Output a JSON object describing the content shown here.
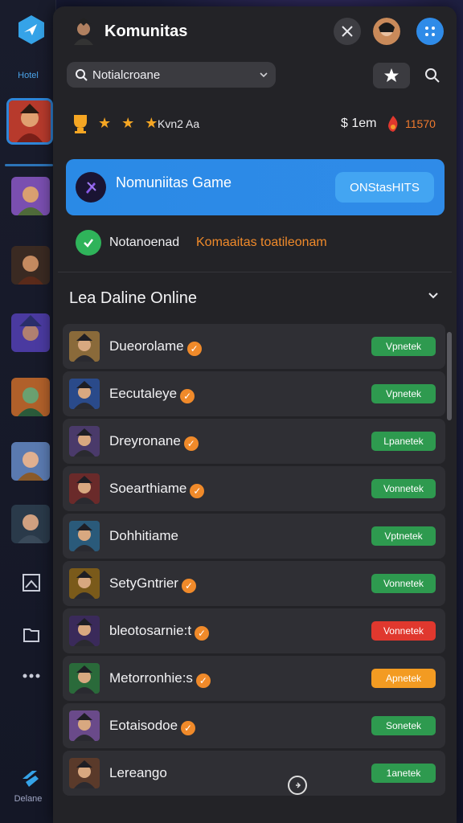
{
  "rail": {
    "top_label": "Hotel",
    "bottom_label": "Delane"
  },
  "header": {
    "title": "Komunitas"
  },
  "search": {
    "value": "Notialcroane"
  },
  "stats": {
    "stars": "★ ★ ★",
    "rating": "Kvn2 Aa",
    "price": "$ 1em",
    "count": "11570"
  },
  "banner": {
    "title": "Nomuniitas Game",
    "button": "ONStasHITS"
  },
  "notice": {
    "status": "Notanoenad",
    "highlight": "Komaaitas toatileonam"
  },
  "section": {
    "title": "Lea Daline Online"
  },
  "colors": {
    "green": "#2e9a4f",
    "red": "#e0382e",
    "orange": "#f39b22",
    "accent": "#2f8be8"
  },
  "list": [
    {
      "name": "Dueorolame",
      "badge": true,
      "button": "Vpnetek",
      "status": "green"
    },
    {
      "name": "Eecutaleye",
      "badge": true,
      "button": "Vpnetek",
      "status": "green"
    },
    {
      "name": "Dreyronane",
      "badge": true,
      "button": "Lpanetek",
      "status": "green"
    },
    {
      "name": "Soearthiame",
      "badge": true,
      "button": "Vonnetek",
      "status": "green"
    },
    {
      "name": "Dohhitiame",
      "badge": false,
      "button": "Vptnetek",
      "status": "green"
    },
    {
      "name": "SetyGntrier",
      "badge": true,
      "button": "Vonnetek",
      "status": "green"
    },
    {
      "name": "bleotosarnie:t",
      "badge": true,
      "button": "Vonnetek",
      "status": "red"
    },
    {
      "name": "Metorronhie:s",
      "badge": true,
      "button": "Apnetek",
      "status": "orange"
    },
    {
      "name": "Eotaisodoe",
      "badge": true,
      "button": "Sonetek",
      "status": "green"
    },
    {
      "name": "Lereango",
      "badge": false,
      "button": "1anetek",
      "status": "green"
    }
  ]
}
